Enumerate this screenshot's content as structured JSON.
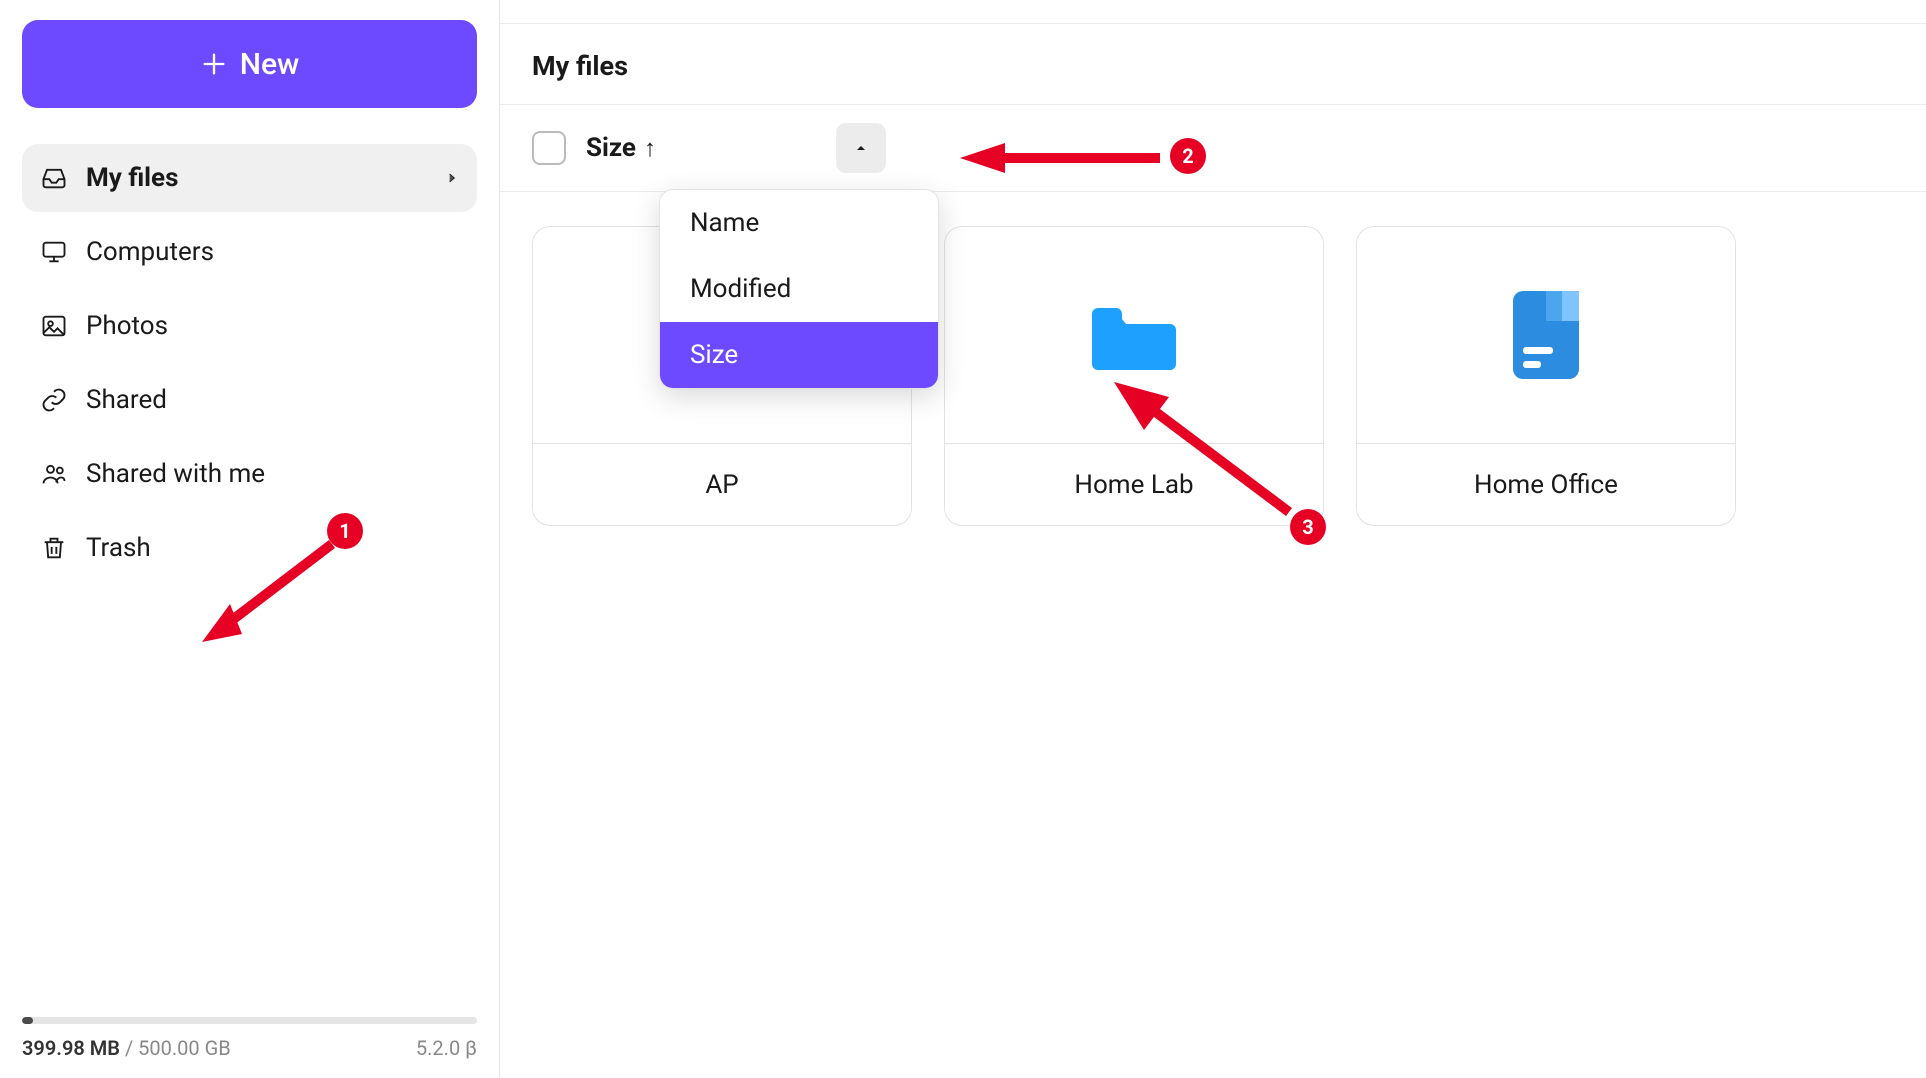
{
  "sidebar": {
    "new_label": "New",
    "items": [
      {
        "label": "My files",
        "icon": "inbox-icon",
        "active": true,
        "chevron": true
      },
      {
        "label": "Computers",
        "icon": "monitor-icon"
      },
      {
        "label": "Photos",
        "icon": "image-icon"
      },
      {
        "label": "Shared",
        "icon": "link-icon"
      },
      {
        "label": "Shared with me",
        "icon": "group-icon"
      },
      {
        "label": "Trash",
        "icon": "trash-icon"
      }
    ],
    "storage": {
      "used": "399.98 MB",
      "sep": " / ",
      "total": "500.00 GB",
      "version": "5.2.0 β"
    }
  },
  "header": {
    "title": "My files"
  },
  "toolbar": {
    "sort_label": "Size",
    "sort_direction": "asc",
    "dropdown": [
      "Name",
      "Modified",
      "Size"
    ],
    "dropdown_selected": 2
  },
  "files": [
    {
      "name": "AP",
      "type": "folder"
    },
    {
      "name": "Home Lab",
      "type": "folder"
    },
    {
      "name": "Home Office",
      "type": "file"
    }
  ],
  "annotations": {
    "badge1": "1",
    "badge2": "2",
    "badge3": "3"
  },
  "colors": {
    "accent": "#6d4aff",
    "annotation": "#e60023",
    "folder": "#1ea0ff",
    "file_dark": "#1579d6",
    "file_light": "#7fc4ff"
  }
}
